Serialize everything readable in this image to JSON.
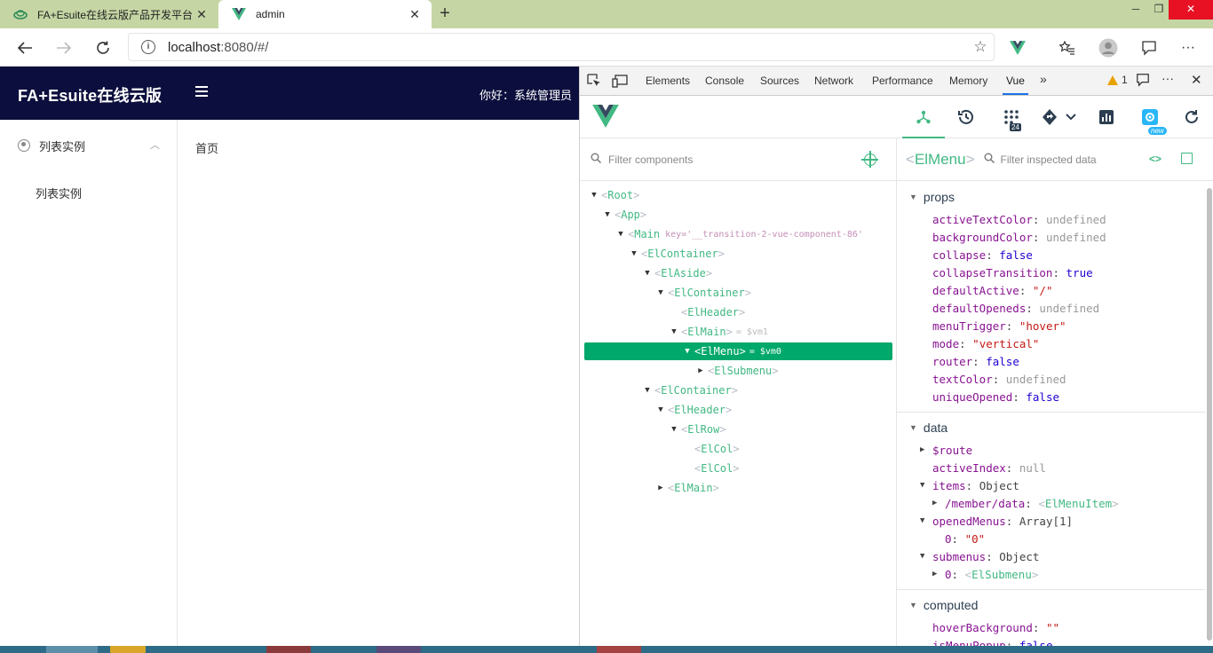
{
  "browser": {
    "tabs": [
      {
        "title": "FA+Esuite在线云版产品开发平台",
        "active": false
      },
      {
        "title": "admin",
        "active": true
      }
    ],
    "address": {
      "host": "localhost",
      "rest": ":8080/#/"
    }
  },
  "page": {
    "brand": "FA+Esuite在线云版",
    "greeting": "你好：系统管理员",
    "sidebar": {
      "submenu_title": "列表实例",
      "item": "列表实例"
    },
    "breadcrumb": "首页"
  },
  "devtools": {
    "tabs": [
      "Elements",
      "Console",
      "Sources",
      "Network",
      "Performance",
      "Memory",
      "Vue"
    ],
    "active_tab": "Vue",
    "warning_count": "1",
    "vue_bar": {
      "events_badge": "24",
      "new_badge": "new"
    },
    "filter_placeholder": "Filter components",
    "tree": [
      {
        "name": "Root",
        "key": "",
        "vm": ""
      },
      {
        "name": "App",
        "key": "",
        "vm": ""
      },
      {
        "name": "Main",
        "key": "key='__transition-2-vue-component-86'",
        "vm": ""
      },
      {
        "name": "ElContainer",
        "key": "",
        "vm": ""
      },
      {
        "name": "ElAside",
        "key": "",
        "vm": ""
      },
      {
        "name": "ElContainer",
        "key": "",
        "vm": ""
      },
      {
        "name": "ElHeader",
        "key": "",
        "vm": ""
      },
      {
        "name": "ElMain",
        "key": "",
        "vm": "= $vm1"
      },
      {
        "name": "ElMenu",
        "key": "",
        "vm": "= $vm0"
      },
      {
        "name": "ElSubmenu",
        "key": "",
        "vm": ""
      },
      {
        "name": "ElContainer",
        "key": "",
        "vm": ""
      },
      {
        "name": "ElHeader",
        "key": "",
        "vm": ""
      },
      {
        "name": "ElRow",
        "key": "",
        "vm": ""
      },
      {
        "name": "ElCol",
        "key": "",
        "vm": ""
      },
      {
        "name": "ElCol",
        "key": "",
        "vm": ""
      },
      {
        "name": "ElMain",
        "key": "",
        "vm": ""
      }
    ],
    "inspector": {
      "component": "ElMenu",
      "filter_placeholder": "Filter inspected data",
      "sections": {
        "props": "props",
        "data": "data",
        "computed": "computed"
      },
      "props": [
        {
          "key": "activeTextColor",
          "value": "undefined"
        },
        {
          "key": "backgroundColor",
          "value": "undefined"
        },
        {
          "key": "collapse",
          "value": "false"
        },
        {
          "key": "collapseTransition",
          "value": "true"
        },
        {
          "key": "defaultActive",
          "value": "\"/\""
        },
        {
          "key": "defaultOpeneds",
          "value": "undefined"
        },
        {
          "key": "menuTrigger",
          "value": "\"hover\""
        },
        {
          "key": "mode",
          "value": "\"vertical\""
        },
        {
          "key": "router",
          "value": "false"
        },
        {
          "key": "textColor",
          "value": "undefined"
        },
        {
          "key": "uniqueOpened",
          "value": "false"
        }
      ],
      "data": [
        {
          "key": "$route",
          "value": ""
        },
        {
          "key": "activeIndex",
          "value": "null"
        },
        {
          "key": "items",
          "value": "Object"
        },
        {
          "key": "/member/data",
          "value": "ElMenuItem"
        },
        {
          "key": "openedMenus",
          "value": "Array[1]"
        },
        {
          "key": "0",
          "value": "\"0\""
        },
        {
          "key": "submenus",
          "value": "Object"
        },
        {
          "key": "0",
          "value": "ElSubmenu"
        }
      ],
      "computed": [
        {
          "key": "hoverBackground",
          "value": "\"\""
        },
        {
          "key": "isMenuPopup",
          "value": "false"
        }
      ]
    }
  },
  "colors": {
    "vue_green": "#42b883",
    "selected_row": "#00a86b",
    "header_navy": "#0c0f3d",
    "tabstrip": "#c5d6a4"
  }
}
